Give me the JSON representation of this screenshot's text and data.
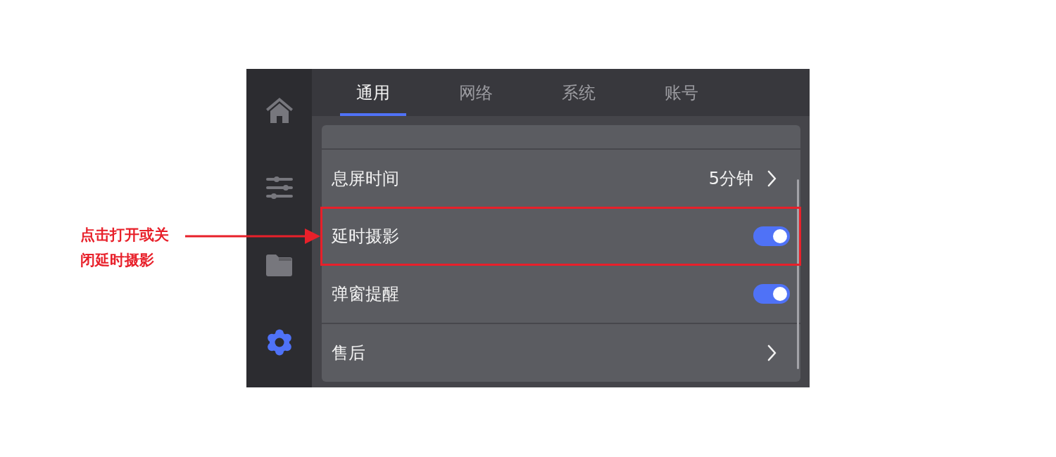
{
  "annotation": {
    "text": "点击打开或关闭延时摄影"
  },
  "sidebar": {
    "items": [
      {
        "kind": "home",
        "selected": false
      },
      {
        "kind": "sliders",
        "selected": false
      },
      {
        "kind": "folder",
        "selected": false
      },
      {
        "kind": "gear",
        "selected": true
      }
    ]
  },
  "tabs": [
    {
      "label": "通用",
      "selected": true
    },
    {
      "label": "网络",
      "selected": false
    },
    {
      "label": "系统",
      "selected": false
    },
    {
      "label": "账号",
      "selected": false
    }
  ],
  "settings": {
    "groups": [
      {
        "rows": [
          {
            "kind": "nav",
            "label": "息屏时间",
            "value": "5分钟",
            "highlighted": false
          },
          {
            "kind": "toggle",
            "label": "延时摄影",
            "on": true,
            "highlighted": true
          },
          {
            "kind": "toggle",
            "label": "弹窗提醒",
            "on": true,
            "highlighted": false
          }
        ]
      },
      {
        "rows": [
          {
            "kind": "nav",
            "label": "售后",
            "highlighted": false
          }
        ]
      }
    ]
  }
}
